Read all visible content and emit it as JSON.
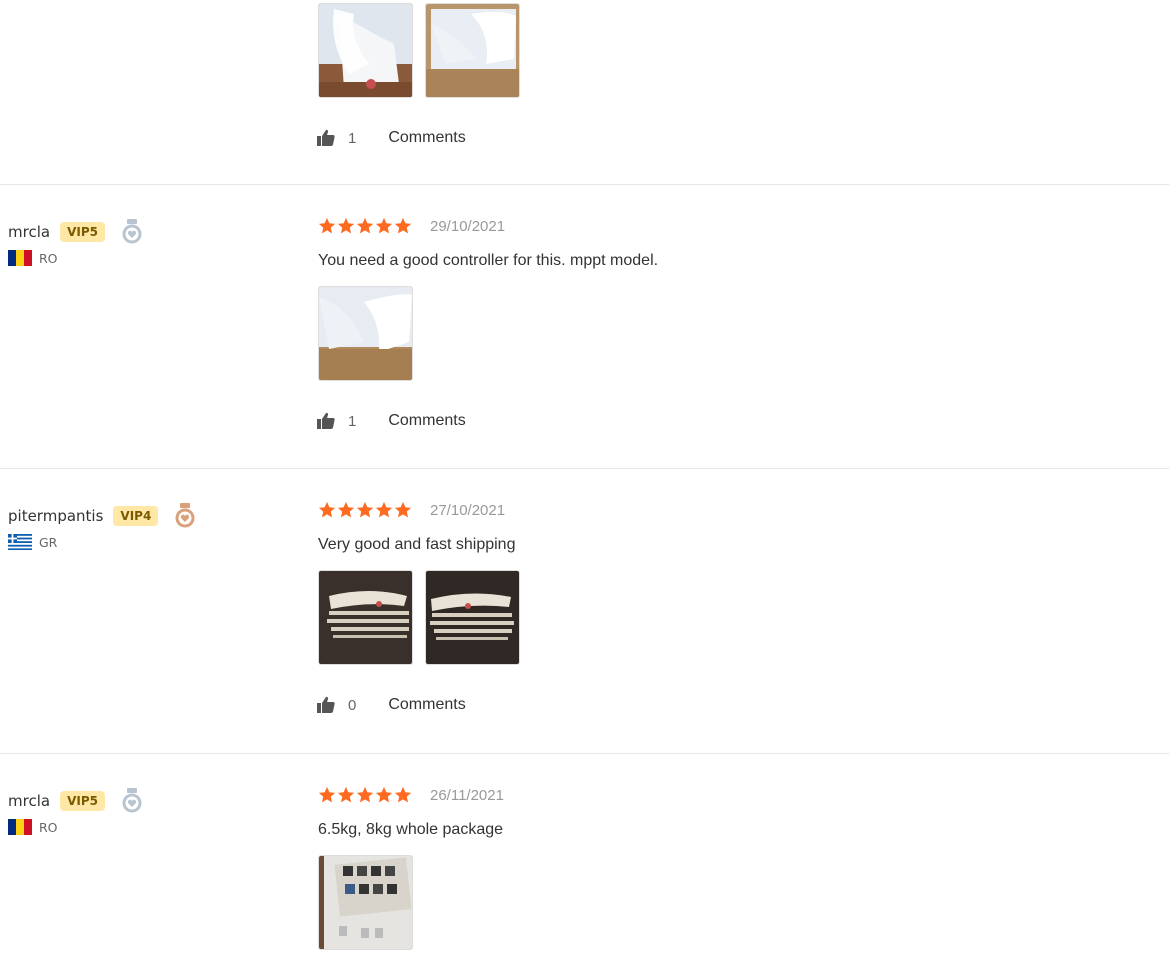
{
  "partial_review": {
    "images": [
      "review-photo-1",
      "review-photo-2"
    ],
    "likes": "1",
    "comments_label": "Comments"
  },
  "reviews": [
    {
      "username": "mrcla",
      "vip": "VIP5",
      "medal": "silver-medal-icon",
      "country": "RO",
      "flag": "romania-flag-icon",
      "rating": 5,
      "date": "29/10/2021",
      "text": "You need a good controller for this. mppt model.",
      "likes": "1",
      "comments_label": "Comments"
    },
    {
      "username": "pitermpantis",
      "vip": "VIP4",
      "medal": "bronze-medal-icon",
      "country": "GR",
      "flag": "greece-flag-icon",
      "rating": 5,
      "date": "27/10/2021",
      "text": "Very good and fast shipping",
      "likes": "0",
      "comments_label": "Comments"
    },
    {
      "username": "mrcla",
      "vip": "VIP5",
      "medal": "silver-medal-icon",
      "country": "RO",
      "flag": "romania-flag-icon",
      "rating": 5,
      "date": "26/11/2021",
      "text": "6.5kg, 8kg whole package",
      "likes": null,
      "comments_label": null
    }
  ],
  "colors": {
    "star": "#ff6a21",
    "vip_bg": "#ffe8a6",
    "divider": "#e6e6e6"
  }
}
